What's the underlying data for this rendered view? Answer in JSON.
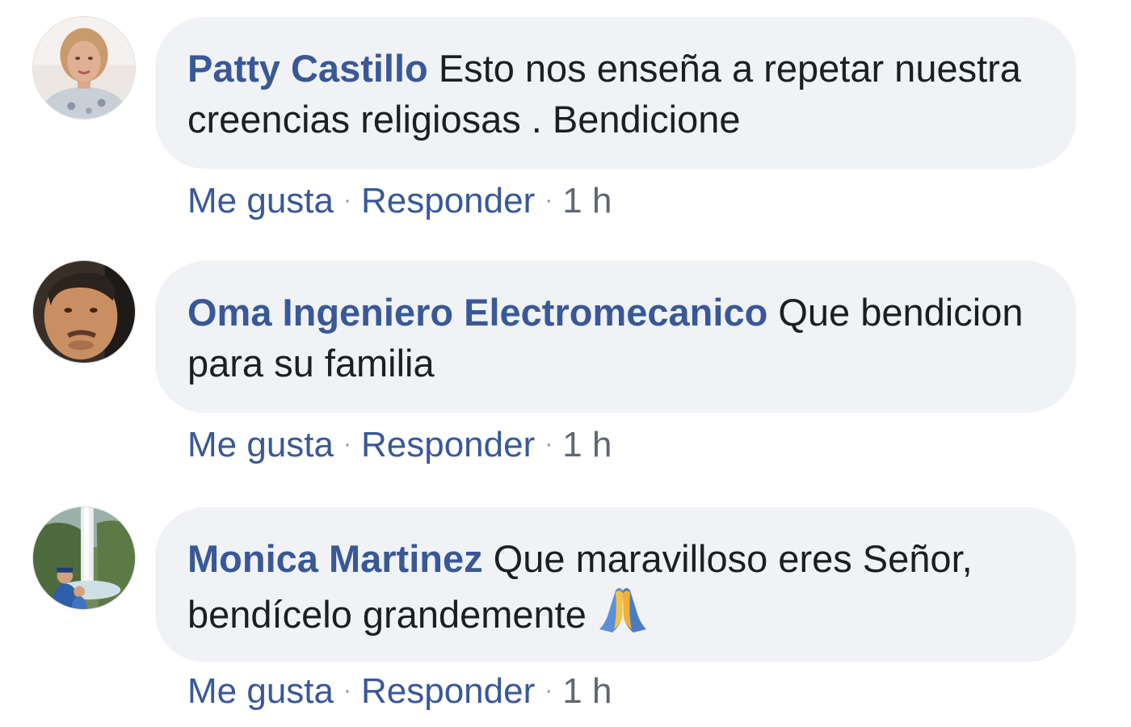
{
  "comments": [
    {
      "author": "Patty Castillo",
      "text": "Esto nos enseña a repetar nuestra creencias religiosas . Bendicione",
      "like_label": "Me gusta",
      "reply_label": "Responder",
      "separator": "·",
      "time": "1 h",
      "avatar_icon": "profile-photo-woman"
    },
    {
      "author": "Oma Ingeniero Electromecanico",
      "text": "Que bendicion para su familia",
      "like_label": "Me gusta",
      "reply_label": "Responder",
      "separator": "·",
      "time": "1 h",
      "avatar_icon": "profile-photo-man"
    },
    {
      "author": "Monica Martinez",
      "text": "Que maravilloso eres Señor, bendícelo grandemente",
      "emoji": "folded-hands-emoji",
      "like_label": "Me gusta",
      "reply_label": "Responder",
      "separator": "·",
      "time": "1 h",
      "avatar_icon": "profile-photo-waterfall"
    }
  ],
  "colors": {
    "author_link": "#385898",
    "bubble_bg": "#f0f2f5",
    "body_text": "#1c1e21",
    "meta_text": "#606770"
  }
}
